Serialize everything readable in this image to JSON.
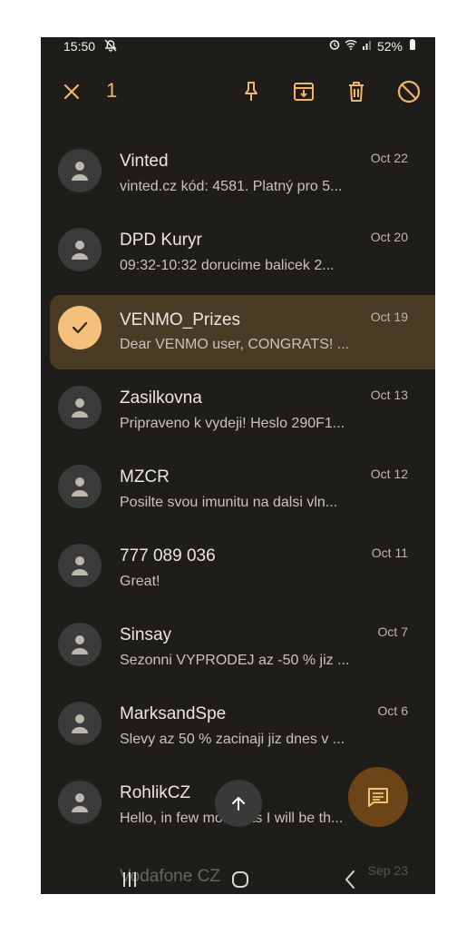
{
  "status_bar": {
    "time": "15:50",
    "battery": "52%"
  },
  "toolbar": {
    "selected_count": "1",
    "icons": [
      "close-icon",
      "pin-icon",
      "archive-icon",
      "delete-icon",
      "block-icon"
    ]
  },
  "colors": {
    "accent": "#f2b56b",
    "background": "#1e1d1a",
    "selected_row": "#4a3c24"
  },
  "messages": [
    {
      "sender": "Vinted",
      "snippet": "vinted.cz kód: 4581. Platný pro 5...",
      "date": "Oct 22"
    },
    {
      "sender": "DPD Kuryr",
      "snippet": "09:32-10:32 dorucime balicek 2...",
      "date": "Oct 20"
    },
    {
      "sender": "VENMO_Prizes",
      "snippet": "Dear VENMO user, CONGRATS! ...",
      "date": "Oct 19"
    },
    {
      "sender": "Zasilkovna",
      "snippet": "Pripraveno k vydeji! Heslo 290F1...",
      "date": "Oct 13"
    },
    {
      "sender": "MZCR",
      "snippet": "Posilte svou imunitu na dalsi vln...",
      "date": "Oct 12"
    },
    {
      "sender": "777 089 036",
      "snippet": "Great!",
      "date": "Oct 11"
    },
    {
      "sender": "Sinsay",
      "snippet": "Sezonni VYPRODEJ az -50 % jiz ...",
      "date": "Oct 7"
    },
    {
      "sender": "MarksandSpe",
      "snippet": "Slevy az 50 % zacinaji jiz dnes v ...",
      "date": "Oct 6"
    },
    {
      "sender": "RohlikCZ",
      "snippet": "Hello, in few moments I will be th...",
      "date": ""
    },
    {
      "sender": "Vodafone CZ",
      "snippet": "",
      "date": "Sep 23"
    }
  ]
}
